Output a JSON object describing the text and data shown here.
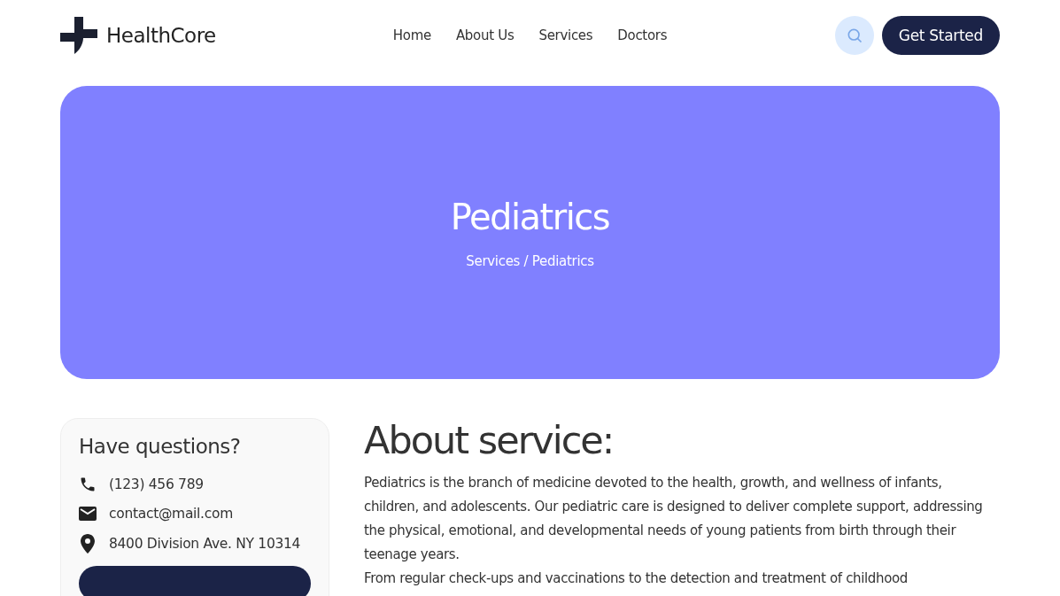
{
  "header": {
    "brand": "HealthCore",
    "nav": [
      {
        "label": "Home"
      },
      {
        "label": "About Us"
      },
      {
        "label": "Services"
      },
      {
        "label": "Doctors"
      }
    ],
    "cta": "Get Started"
  },
  "hero": {
    "title": "Pediatrics",
    "breadcrumb": "Services / Pediatrics"
  },
  "sidebar": {
    "title": "Have questions?",
    "contacts": [
      {
        "kind": "phone",
        "text": "(123) 456 789"
      },
      {
        "kind": "mail",
        "text": "contact@mail.com"
      },
      {
        "kind": "location",
        "text": "8400 Division Ave. NY 10314"
      }
    ]
  },
  "main": {
    "heading": "About service:",
    "paragraphs": [
      "Pediatrics is the branch of medicine devoted to the health, growth, and wellness of infants, children, and adolescents. Our pediatric care is designed to deliver complete support, addressing the physical, emotional, and developmental needs of young patients from birth through their teenage years.",
      "From regular check-ups and vaccinations to the detection and treatment of childhood"
    ]
  }
}
